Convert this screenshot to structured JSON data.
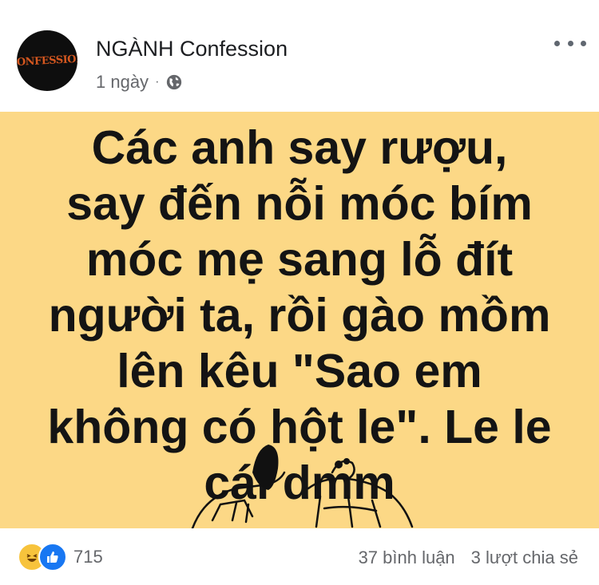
{
  "post": {
    "page_name": "NGÀNH Confession",
    "time": "1 ngày",
    "separator": "·",
    "privacy_icon": "globe-icon",
    "avatar_text": "CONFESSION",
    "lines": [
      "Các anh say rượu,",
      "say đến nỗi móc bím",
      "móc mẹ sang lỗ đít",
      "người ta, rồi gào mồm",
      "lên kêu \"Sao em",
      "không có hột le\". Le le",
      "cái dmm"
    ],
    "background_color": "#fcd886"
  },
  "footer": {
    "reaction_icons": [
      "haha-icon",
      "like-icon"
    ],
    "reaction_count": "715",
    "comments": "37 bình luận",
    "shares": "3 lượt chia sẻ"
  }
}
